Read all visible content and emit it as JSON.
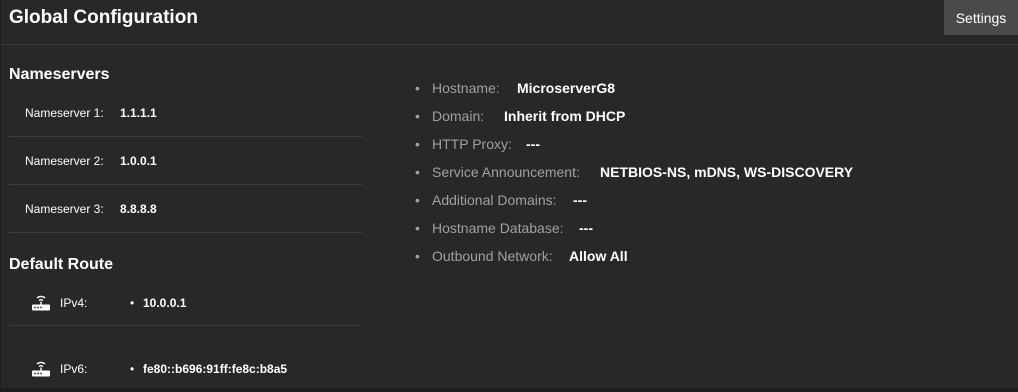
{
  "header": {
    "title": "Global Configuration",
    "settings_label": "Settings"
  },
  "nameservers": {
    "title": "Nameservers",
    "items": [
      {
        "label": "Nameserver 1:",
        "value": "1.1.1.1"
      },
      {
        "label": "Nameserver 2:",
        "value": "1.0.0.1"
      },
      {
        "label": "Nameserver 3:",
        "value": "8.8.8.8"
      }
    ]
  },
  "default_route": {
    "title": "Default Route",
    "items": [
      {
        "icon": "router-icon",
        "label": "IPv4:",
        "bullet": "•",
        "value": "10.0.0.1"
      },
      {
        "icon": "router-icon",
        "label": "IPv6:",
        "bullet": "•",
        "value": "fe80::b696:91ff:fe8c:b8a5"
      }
    ]
  },
  "info": {
    "bullet": "•",
    "items": [
      {
        "label": "Hostname:",
        "value": "MicroserverG8"
      },
      {
        "label": "Domain:",
        "value": "Inherit from DHCP"
      },
      {
        "label": "HTTP Proxy:",
        "value": "---"
      },
      {
        "label": "Service Announcement:",
        "value": "NETBIOS-NS, mDNS, WS-DISCOVERY"
      },
      {
        "label": "Additional Domains:",
        "value": "---"
      },
      {
        "label": "Hostname Database:",
        "value": "---"
      },
      {
        "label": "Outbound Network:",
        "value": "Allow All"
      }
    ]
  },
  "colors": {
    "background": "#282828",
    "button_bg": "#4a4a4a",
    "label_muted": "#a0a0a0",
    "text": "#ffffff",
    "divider": "#3e3e3e"
  }
}
